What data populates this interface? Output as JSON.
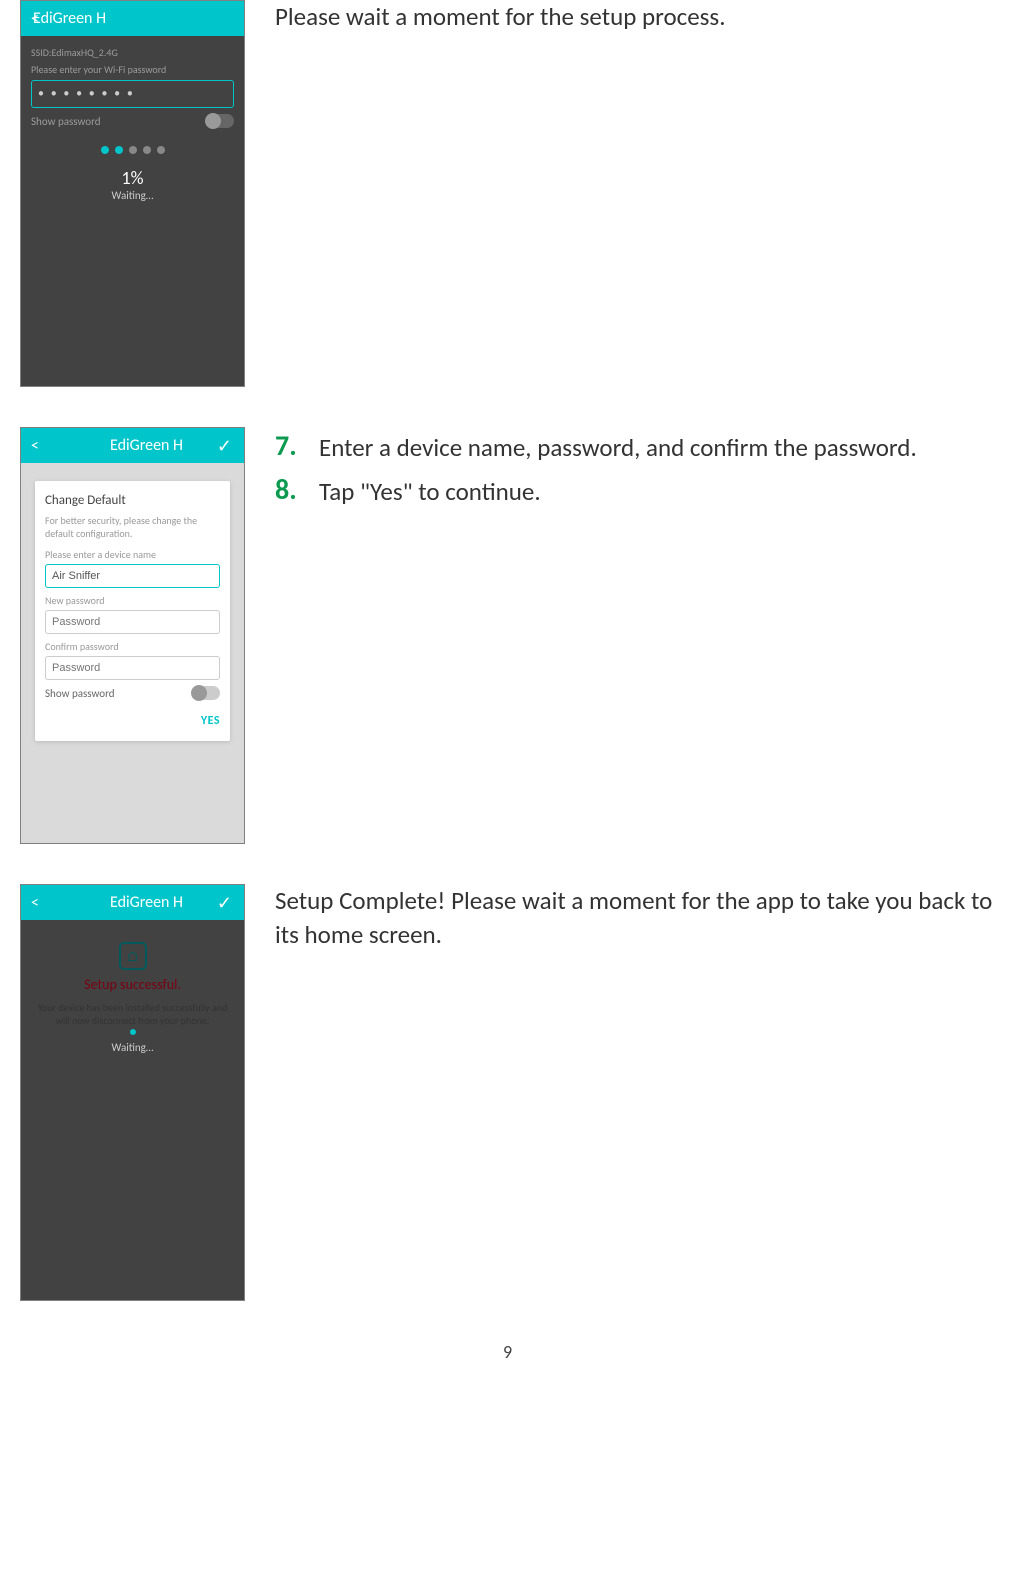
{
  "sections": {
    "s1": {
      "app_title": "EdiGreen H",
      "ssid_label": "SSID:EdimaxHQ_2.4G",
      "pwd_hint": "Please enter your Wi-Fi password",
      "pwd_value": "•  •  •  •  •  •  •  •",
      "showpwd": "Show password",
      "percent": "1%",
      "waiting": "Waiting…",
      "caption": "Please wait a moment for the setup process."
    },
    "s2": {
      "app_title": "EdiGreen H",
      "card_title": "Change Default",
      "card_sub": "For better security, please change the default configuration.",
      "name_label": "Please enter a device name",
      "name_value": "Air Sniffer",
      "newpwd_label": "New password",
      "newpwd_ph": "Password",
      "conf_label": "Confirm password",
      "conf_ph": "Password",
      "showpwd": "Show password",
      "yes": "YES",
      "step7num": "7.",
      "step7text": "Enter a device name, password, and confirm the password.",
      "step8num": "8.",
      "step8text": "Tap \"Yes\" to continue."
    },
    "s3": {
      "app_title": "EdiGreen H",
      "success_title": "Setup successful.",
      "success_body": "Your device has been installed successfully and will now disconnect from your phone.",
      "waiting": "Waiting…",
      "caption": "Setup Complete! Please wait a moment for the app to take you back to its home screen."
    }
  },
  "page_number": "9"
}
